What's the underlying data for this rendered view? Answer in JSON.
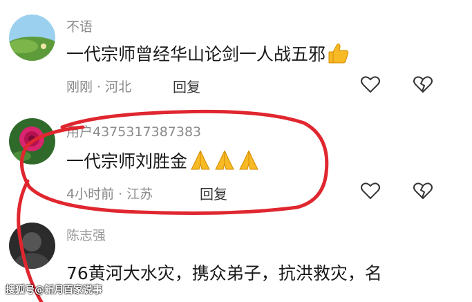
{
  "comments": [
    {
      "username": "不语",
      "text": "一代宗师曾经华山论剑一人战五邪",
      "emoji": "thumbs-up",
      "time": "刚刚",
      "location": "河北",
      "reply": "回复",
      "avatar": "landscape-avatar"
    },
    {
      "username": "用户4375317387383",
      "text": "一代宗师刘胜金",
      "emoji": "praying-hands x3",
      "time": "4小时前",
      "location": "江苏",
      "reply": "回复",
      "avatar": "rose-avatar"
    },
    {
      "username": "陈志强",
      "text": "76黄河大水灾，携众弟子，抗洪救灾，名",
      "avatar": "dark-avatar"
    }
  ],
  "separator": " · ",
  "watermark": "搜狐号@新月百家说事",
  "icons": {
    "like": "heart-outline-icon",
    "dislike": "broken-heart-icon"
  },
  "colors": {
    "highlight_circle": "#e0262f",
    "meta": "#8a8a8a",
    "text": "#1a1a1a"
  }
}
